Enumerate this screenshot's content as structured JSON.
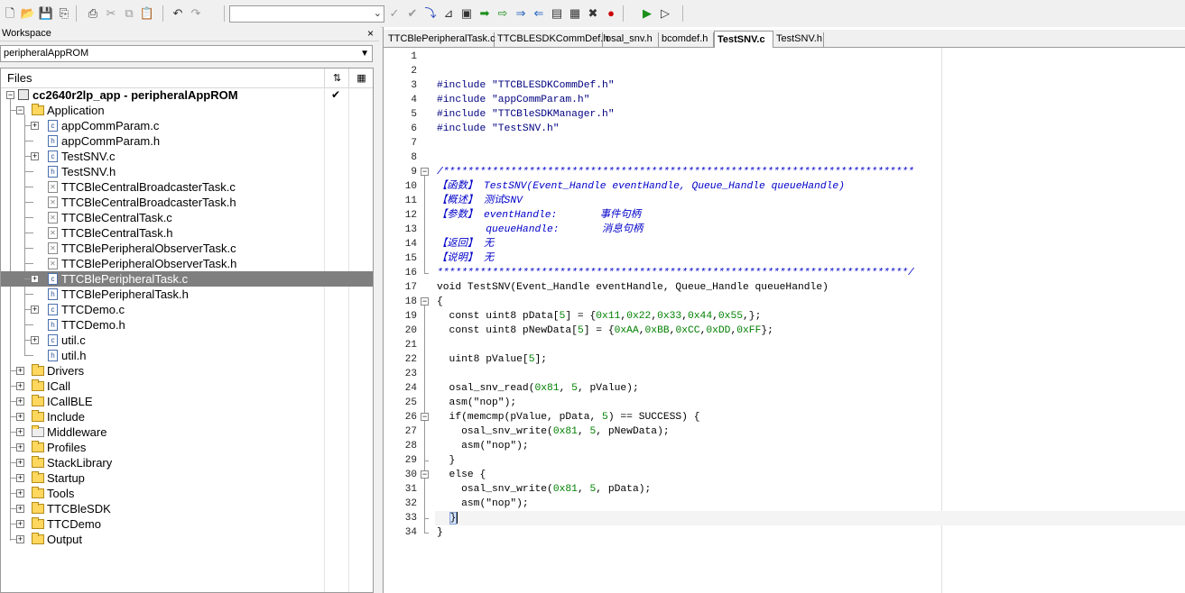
{
  "toolbar": {
    "combo_value": "",
    "icons": [
      "new-file-icon",
      "open-file-icon",
      "save-icon",
      "save-all-icon",
      "print-icon",
      "cut-icon",
      "copy-icon",
      "paste-icon",
      "undo-icon",
      "redo-icon",
      "find-icon",
      "find-next-icon",
      "go-to-icon",
      "bookmark-icon",
      "toggle-bookmark-icon",
      "next-bookmark-icon",
      "prev-bookmark-icon",
      "navigate-forward-icon",
      "navigate-back-icon",
      "compile-icon",
      "make-icon",
      "stop-build-icon",
      "toggle-breakpoint-icon",
      "download-debug-icon",
      "debug-without-download-icon"
    ]
  },
  "workspace": {
    "title": "Workspace",
    "close": "×",
    "config": "peripheralAppROM",
    "files_label": "Files",
    "project": "cc2640r2lp_app - peripheralAppROM",
    "project_check": "✔",
    "tree": [
      {
        "label": "Application",
        "type": "folder",
        "level": 1,
        "expander": "−"
      },
      {
        "label": "appCommParam.c",
        "type": "c",
        "level": 2,
        "expander": "+"
      },
      {
        "label": "appCommParam.h",
        "type": "h",
        "level": 2,
        "expander": ""
      },
      {
        "label": "TestSNV.c",
        "type": "c",
        "level": 2,
        "expander": "+"
      },
      {
        "label": "TestSNV.h",
        "type": "h",
        "level": 2,
        "expander": ""
      },
      {
        "label": "TTCBleCentralBroadcasterTask.c",
        "type": "x",
        "level": 2,
        "expander": ""
      },
      {
        "label": "TTCBleCentralBroadcasterTask.h",
        "type": "x",
        "level": 2,
        "expander": ""
      },
      {
        "label": "TTCBleCentralTask.c",
        "type": "x",
        "level": 2,
        "expander": ""
      },
      {
        "label": "TTCBleCentralTask.h",
        "type": "x",
        "level": 2,
        "expander": ""
      },
      {
        "label": "TTCBlePeripheralObserverTask.c",
        "type": "x",
        "level": 2,
        "expander": ""
      },
      {
        "label": "TTCBlePeripheralObserverTask.h",
        "type": "x",
        "level": 2,
        "expander": ""
      },
      {
        "label": "TTCBlePeripheralTask.c",
        "type": "c",
        "level": 2,
        "expander": "+",
        "selected": true
      },
      {
        "label": "TTCBlePeripheralTask.h",
        "type": "h",
        "level": 2,
        "expander": ""
      },
      {
        "label": "TTCDemo.c",
        "type": "c",
        "level": 2,
        "expander": "+"
      },
      {
        "label": "TTCDemo.h",
        "type": "h",
        "level": 2,
        "expander": ""
      },
      {
        "label": "util.c",
        "type": "c",
        "level": 2,
        "expander": "+"
      },
      {
        "label": "util.h",
        "type": "h",
        "level": 2,
        "expander": ""
      },
      {
        "label": "Drivers",
        "type": "folder",
        "level": 1,
        "expander": "+"
      },
      {
        "label": "ICall",
        "type": "folder",
        "level": 1,
        "expander": "+"
      },
      {
        "label": "ICallBLE",
        "type": "folder",
        "level": 1,
        "expander": "+"
      },
      {
        "label": "Include",
        "type": "folder",
        "level": 1,
        "expander": "+"
      },
      {
        "label": "Middleware",
        "type": "xfolder",
        "level": 1,
        "expander": "+"
      },
      {
        "label": "Profiles",
        "type": "folder",
        "level": 1,
        "expander": "+"
      },
      {
        "label": "StackLibrary",
        "type": "folder",
        "level": 1,
        "expander": "+"
      },
      {
        "label": "Startup",
        "type": "folder",
        "level": 1,
        "expander": "+"
      },
      {
        "label": "Tools",
        "type": "folder",
        "level": 1,
        "expander": "+"
      },
      {
        "label": "TTCBleSDK",
        "type": "folder",
        "level": 1,
        "expander": "+"
      },
      {
        "label": "TTCDemo",
        "type": "folder",
        "level": 1,
        "expander": "+"
      },
      {
        "label": "Output",
        "type": "folder",
        "level": 1,
        "expander": "+"
      }
    ]
  },
  "editor": {
    "tabs": [
      {
        "label": "TTCBlePeripheralTask.c",
        "active": false
      },
      {
        "label": "TTCBLESDKCommDef.h",
        "active": false
      },
      {
        "label": "osal_snv.h",
        "active": false
      },
      {
        "label": "bcomdef.h",
        "active": false
      },
      {
        "label": "TestSNV.c",
        "active": true
      },
      {
        "label": "TestSNV.h",
        "active": false
      }
    ],
    "current_line": 33,
    "lines": [
      {
        "n": "1",
        "t": ""
      },
      {
        "n": "2",
        "t": ""
      },
      {
        "n": "3",
        "t": "#include \"TTCBLESDKCommDef.h\"",
        "cls": "pp"
      },
      {
        "n": "4",
        "t": "#include \"appCommParam.h\"",
        "cls": "pp"
      },
      {
        "n": "5",
        "t": "#include \"TTCBleSDKManager.h\"",
        "cls": "pp"
      },
      {
        "n": "6",
        "t": "#include \"TestSNV.h\"",
        "cls": "pp"
      },
      {
        "n": "7",
        "t": ""
      },
      {
        "n": "8",
        "t": ""
      },
      {
        "n": "9",
        "t": "/*****************************************************************************",
        "cls": "cm",
        "fold": "−"
      },
      {
        "n": "10",
        "t": "【函数】 TestSNV(Event_Handle eventHandle, Queue_Handle queueHandle)",
        "cls": "cm"
      },
      {
        "n": "11",
        "t": "【概述】 测试SNV",
        "cls": "cm"
      },
      {
        "n": "12",
        "t": "【参数】 eventHandle:       事件句柄",
        "cls": "cm"
      },
      {
        "n": "13",
        "t": "        queueHandle:       消息句柄",
        "cls": "cm"
      },
      {
        "n": "14",
        "t": "【返回】 无",
        "cls": "cm"
      },
      {
        "n": "15",
        "t": "【说明】 无",
        "cls": "cm"
      },
      {
        "n": "16",
        "t": "*****************************************************************************/",
        "cls": "cm",
        "foldend": true
      },
      {
        "n": "17",
        "t": "void TestSNV(Event_Handle eventHandle, Queue_Handle queueHandle)"
      },
      {
        "n": "18",
        "t": "{",
        "fold": "−"
      },
      {
        "n": "19",
        "t": "  const uint8 pData[5] = {0x11,0x22,0x33,0x44,0x55,};"
      },
      {
        "n": "20",
        "t": "  const uint8 pNewData[5] = {0xAA,0xBB,0xCC,0xDD,0xFF};"
      },
      {
        "n": "21",
        "t": ""
      },
      {
        "n": "22",
        "t": "  uint8 pValue[5];"
      },
      {
        "n": "23",
        "t": ""
      },
      {
        "n": "24",
        "t": "  osal_snv_read(0x81, 5, pValue);"
      },
      {
        "n": "25",
        "t": "  asm(\"nop\");"
      },
      {
        "n": "26",
        "t": "  if(memcmp(pValue, pData, 5) == SUCCESS) {",
        "fold": "−"
      },
      {
        "n": "27",
        "t": "    osal_snv_write(0x81, 5, pNewData);"
      },
      {
        "n": "28",
        "t": "    asm(\"nop\");"
      },
      {
        "n": "29",
        "t": "  }",
        "foldend": true
      },
      {
        "n": "30",
        "t": "  else {",
        "fold": "−"
      },
      {
        "n": "31",
        "t": "    osal_snv_write(0x81, 5, pData);"
      },
      {
        "n": "32",
        "t": "    asm(\"nop\");"
      },
      {
        "n": "33",
        "t": "  }",
        "foldend": true
      },
      {
        "n": "34",
        "t": "}",
        "foldend": true
      }
    ]
  }
}
